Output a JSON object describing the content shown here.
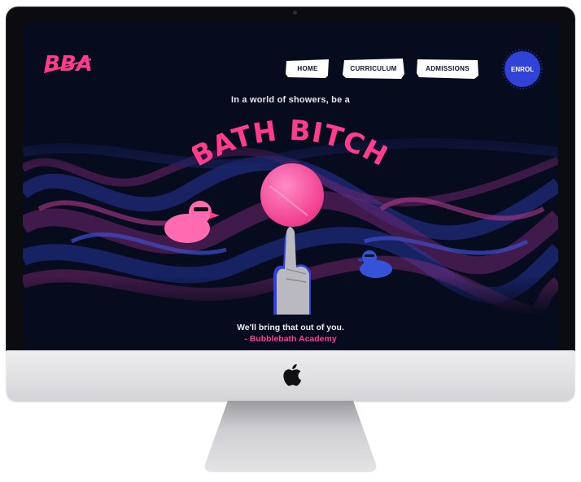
{
  "logo": {
    "text": "BBA",
    "color": "#ff3d8c"
  },
  "nav": {
    "home": "HOME",
    "curriculum": "CURRICULUM",
    "admissions": "ADMISSIONS",
    "enrol": "ENROL"
  },
  "hero": {
    "tagline": "In a world of showers, be a",
    "headline": "BATH BITCH",
    "footer_line": "We'll bring that out of you.",
    "signature": "- Bubblebath Academy"
  },
  "colors": {
    "accent_pink": "#ff3d8c",
    "accent_blue": "#3142d8",
    "background": "#070b1e"
  },
  "icons": [
    "apple-logo-icon",
    "rubber-duck-pink-icon",
    "rubber-duck-blue-icon",
    "finger-icon"
  ]
}
